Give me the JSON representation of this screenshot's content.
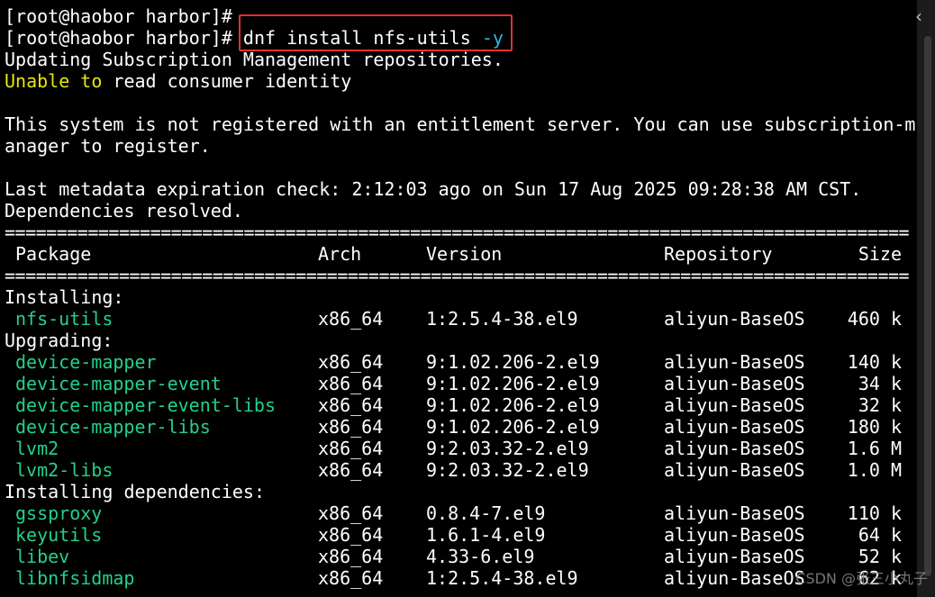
{
  "colors": {
    "background": "#000000",
    "text": "#ffffff",
    "warning": "#e5e510",
    "package": "#23d18b",
    "flag": "#29b8db",
    "highlight_box": "#e03030"
  },
  "icons": {
    "collapse": "chevron-left-icon"
  },
  "terminal": {
    "prompt_line_1": "[root@haobor harbor]#",
    "prompt_line_2": "[root@haobor harbor]# ",
    "command_text": "dnf install nfs-utils ",
    "command_flag": "-y",
    "msg_updating": "Updating Subscription Management repositories.",
    "warn_unable_to": "Unable to",
    "warn_rest": " read consumer identity",
    "msg_not_registered_1": "This system is not registered with an entitlement server. You can use subscription-m",
    "msg_not_registered_2": "anager to register.",
    "msg_metadata": "Last metadata expiration check: 2:12:03 ago on Sun 17 Aug 2025 09:28:38 AM CST.",
    "msg_deps": "Dependencies resolved.",
    "separator": "=======================================================================================",
    "header": {
      "package": "Package",
      "arch": "Arch",
      "version": "Version",
      "repository": "Repository",
      "size": "Size"
    },
    "groups": [
      {
        "label": "Installing:",
        "packages": [
          {
            "name": "nfs-utils",
            "arch": "x86_64",
            "version": "1:2.5.4-38.el9",
            "repo": "aliyun-BaseOS",
            "size": "460 k"
          }
        ]
      },
      {
        "label": "Upgrading:",
        "packages": [
          {
            "name": "device-mapper",
            "arch": "x86_64",
            "version": "9:1.02.206-2.el9",
            "repo": "aliyun-BaseOS",
            "size": "140 k"
          },
          {
            "name": "device-mapper-event",
            "arch": "x86_64",
            "version": "9:1.02.206-2.el9",
            "repo": "aliyun-BaseOS",
            "size": "34 k"
          },
          {
            "name": "device-mapper-event-libs",
            "arch": "x86_64",
            "version": "9:1.02.206-2.el9",
            "repo": "aliyun-BaseOS",
            "size": "32 k"
          },
          {
            "name": "device-mapper-libs",
            "arch": "x86_64",
            "version": "9:1.02.206-2.el9",
            "repo": "aliyun-BaseOS",
            "size": "180 k"
          },
          {
            "name": "lvm2",
            "arch": "x86_64",
            "version": "9:2.03.32-2.el9",
            "repo": "aliyun-BaseOS",
            "size": "1.6 M"
          },
          {
            "name": "lvm2-libs",
            "arch": "x86_64",
            "version": "9:2.03.32-2.el9",
            "repo": "aliyun-BaseOS",
            "size": "1.0 M"
          }
        ]
      },
      {
        "label": "Installing dependencies:",
        "packages": [
          {
            "name": "gssproxy",
            "arch": "x86_64",
            "version": "0.8.4-7.el9",
            "repo": "aliyun-BaseOS",
            "size": "110 k"
          },
          {
            "name": "keyutils",
            "arch": "x86_64",
            "version": "1.6.1-4.el9",
            "repo": "aliyun-BaseOS",
            "size": "64 k"
          },
          {
            "name": "libev",
            "arch": "x86_64",
            "version": "4.33-6.el9",
            "repo": "aliyun-BaseOS",
            "size": "52 k"
          },
          {
            "name": "libnfsidmap",
            "arch": "x86_64",
            "version": "1:2.5.4-38.el9",
            "repo": "aliyun-BaseOS",
            "size": "62 k"
          }
        ]
      }
    ]
  },
  "watermark": "CSDN @张三小丸子"
}
